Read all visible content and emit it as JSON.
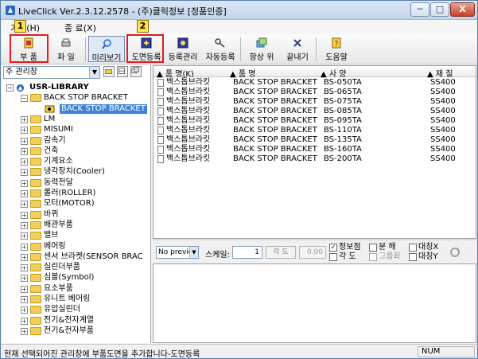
{
  "window": {
    "title": "LiveClick Ver.2.3.12.2578 - (주)클릭정보 [정품인증]",
    "min_label": "─",
    "max_label": "□",
    "close_label": "X"
  },
  "menu": {
    "items": [
      "기능(H)",
      "종 료(X)"
    ]
  },
  "toolbar": {
    "buttons": [
      {
        "label": "부 품"
      },
      {
        "label": "파 일"
      },
      {
        "label": "미리보기"
      },
      {
        "label": "도면등록"
      },
      {
        "label": "등록관리"
      },
      {
        "label": "자동등록"
      },
      {
        "label": "항상 위"
      },
      {
        "label": "끝내기"
      },
      {
        "label": "도움말"
      }
    ],
    "badges": [
      "1",
      "2"
    ]
  },
  "left": {
    "combo_value": "주 관리창",
    "tree": [
      {
        "label": "USR-LIBRARY",
        "level": 0
      },
      {
        "label": "BACK STOP BRACKET",
        "level": 1
      },
      {
        "label": "BACK STOP BRACKET",
        "level": 2,
        "selected": true
      },
      {
        "label": "LM",
        "level": 1
      },
      {
        "label": "MISUMI",
        "level": 1
      },
      {
        "label": "감속기",
        "level": 1
      },
      {
        "label": "건축",
        "level": 1
      },
      {
        "label": "기계요소",
        "level": 1
      },
      {
        "label": "냉각장치(Cooler)",
        "level": 1
      },
      {
        "label": "동력전달",
        "level": 1
      },
      {
        "label": "롤러(ROLLER)",
        "level": 1
      },
      {
        "label": "모터(MOTOR)",
        "level": 1
      },
      {
        "label": "바퀴",
        "level": 1
      },
      {
        "label": "배관부품",
        "level": 1
      },
      {
        "label": "밸브",
        "level": 1
      },
      {
        "label": "베어링",
        "level": 1
      },
      {
        "label": "센서 브라켓(SENSOR BRAC",
        "level": 1
      },
      {
        "label": "실린더부품",
        "level": 1
      },
      {
        "label": "심볼(Symbol)",
        "level": 1
      },
      {
        "label": "요소부품",
        "level": 1
      },
      {
        "label": "유니트 베어링",
        "level": 1
      },
      {
        "label": "유압실린더",
        "level": 1
      },
      {
        "label": "전기&전자계열",
        "level": 1
      },
      {
        "label": "전기&전자부품",
        "level": 1
      }
    ]
  },
  "list": {
    "columns": [
      "품 명(K)",
      "품 명",
      "사 양",
      "재 질"
    ],
    "rows": [
      [
        "백스톱브라킷",
        "BACK STOP BRACKET",
        "BS-050TA",
        "SS400"
      ],
      [
        "백스톱브라킷",
        "BACK STOP BRACKET",
        "BS-065TA",
        "SS400"
      ],
      [
        "백스톱브라킷",
        "BACK STOP BRACKET",
        "BS-075TA",
        "SS400"
      ],
      [
        "백스톱브라킷",
        "BACK STOP BRACKET",
        "BS-085TA",
        "SS400"
      ],
      [
        "백스톱브라킷",
        "BACK STOP BRACKET",
        "BS-095TA",
        "SS400"
      ],
      [
        "백스톱브라킷",
        "BACK STOP BRACKET",
        "BS-110TA",
        "SS400"
      ],
      [
        "백스톱브라킷",
        "BACK STOP BRACKET",
        "BS-135TA",
        "SS400"
      ],
      [
        "백스톱브라킷",
        "BACK STOP BRACKET",
        "BS-160TA",
        "SS400"
      ],
      [
        "백스톱브라킷",
        "BACK STOP BRACKET",
        "BS-200TA",
        "SS400"
      ]
    ]
  },
  "preview": {
    "mode": "No preview",
    "scale_label": "스케일:",
    "scale_value": "1",
    "angle_button": "각 도",
    "angle_value": "0.00",
    "checks": [
      {
        "label": "정보점",
        "checked": true,
        "enabled": true
      },
      {
        "label": "각 도",
        "checked": false,
        "enabled": true
      },
      {
        "label": "분 해",
        "checked": false,
        "enabled": true
      },
      {
        "label": "그룹화",
        "checked": false,
        "enabled": false
      },
      {
        "label": "대칭X",
        "checked": false,
        "enabled": true
      },
      {
        "label": "대칭Y",
        "checked": false,
        "enabled": true
      }
    ]
  },
  "status": {
    "message": "현재 선택되어진 관리창에 부품도면을 추가합니다-도면등록",
    "num": "NUM"
  }
}
